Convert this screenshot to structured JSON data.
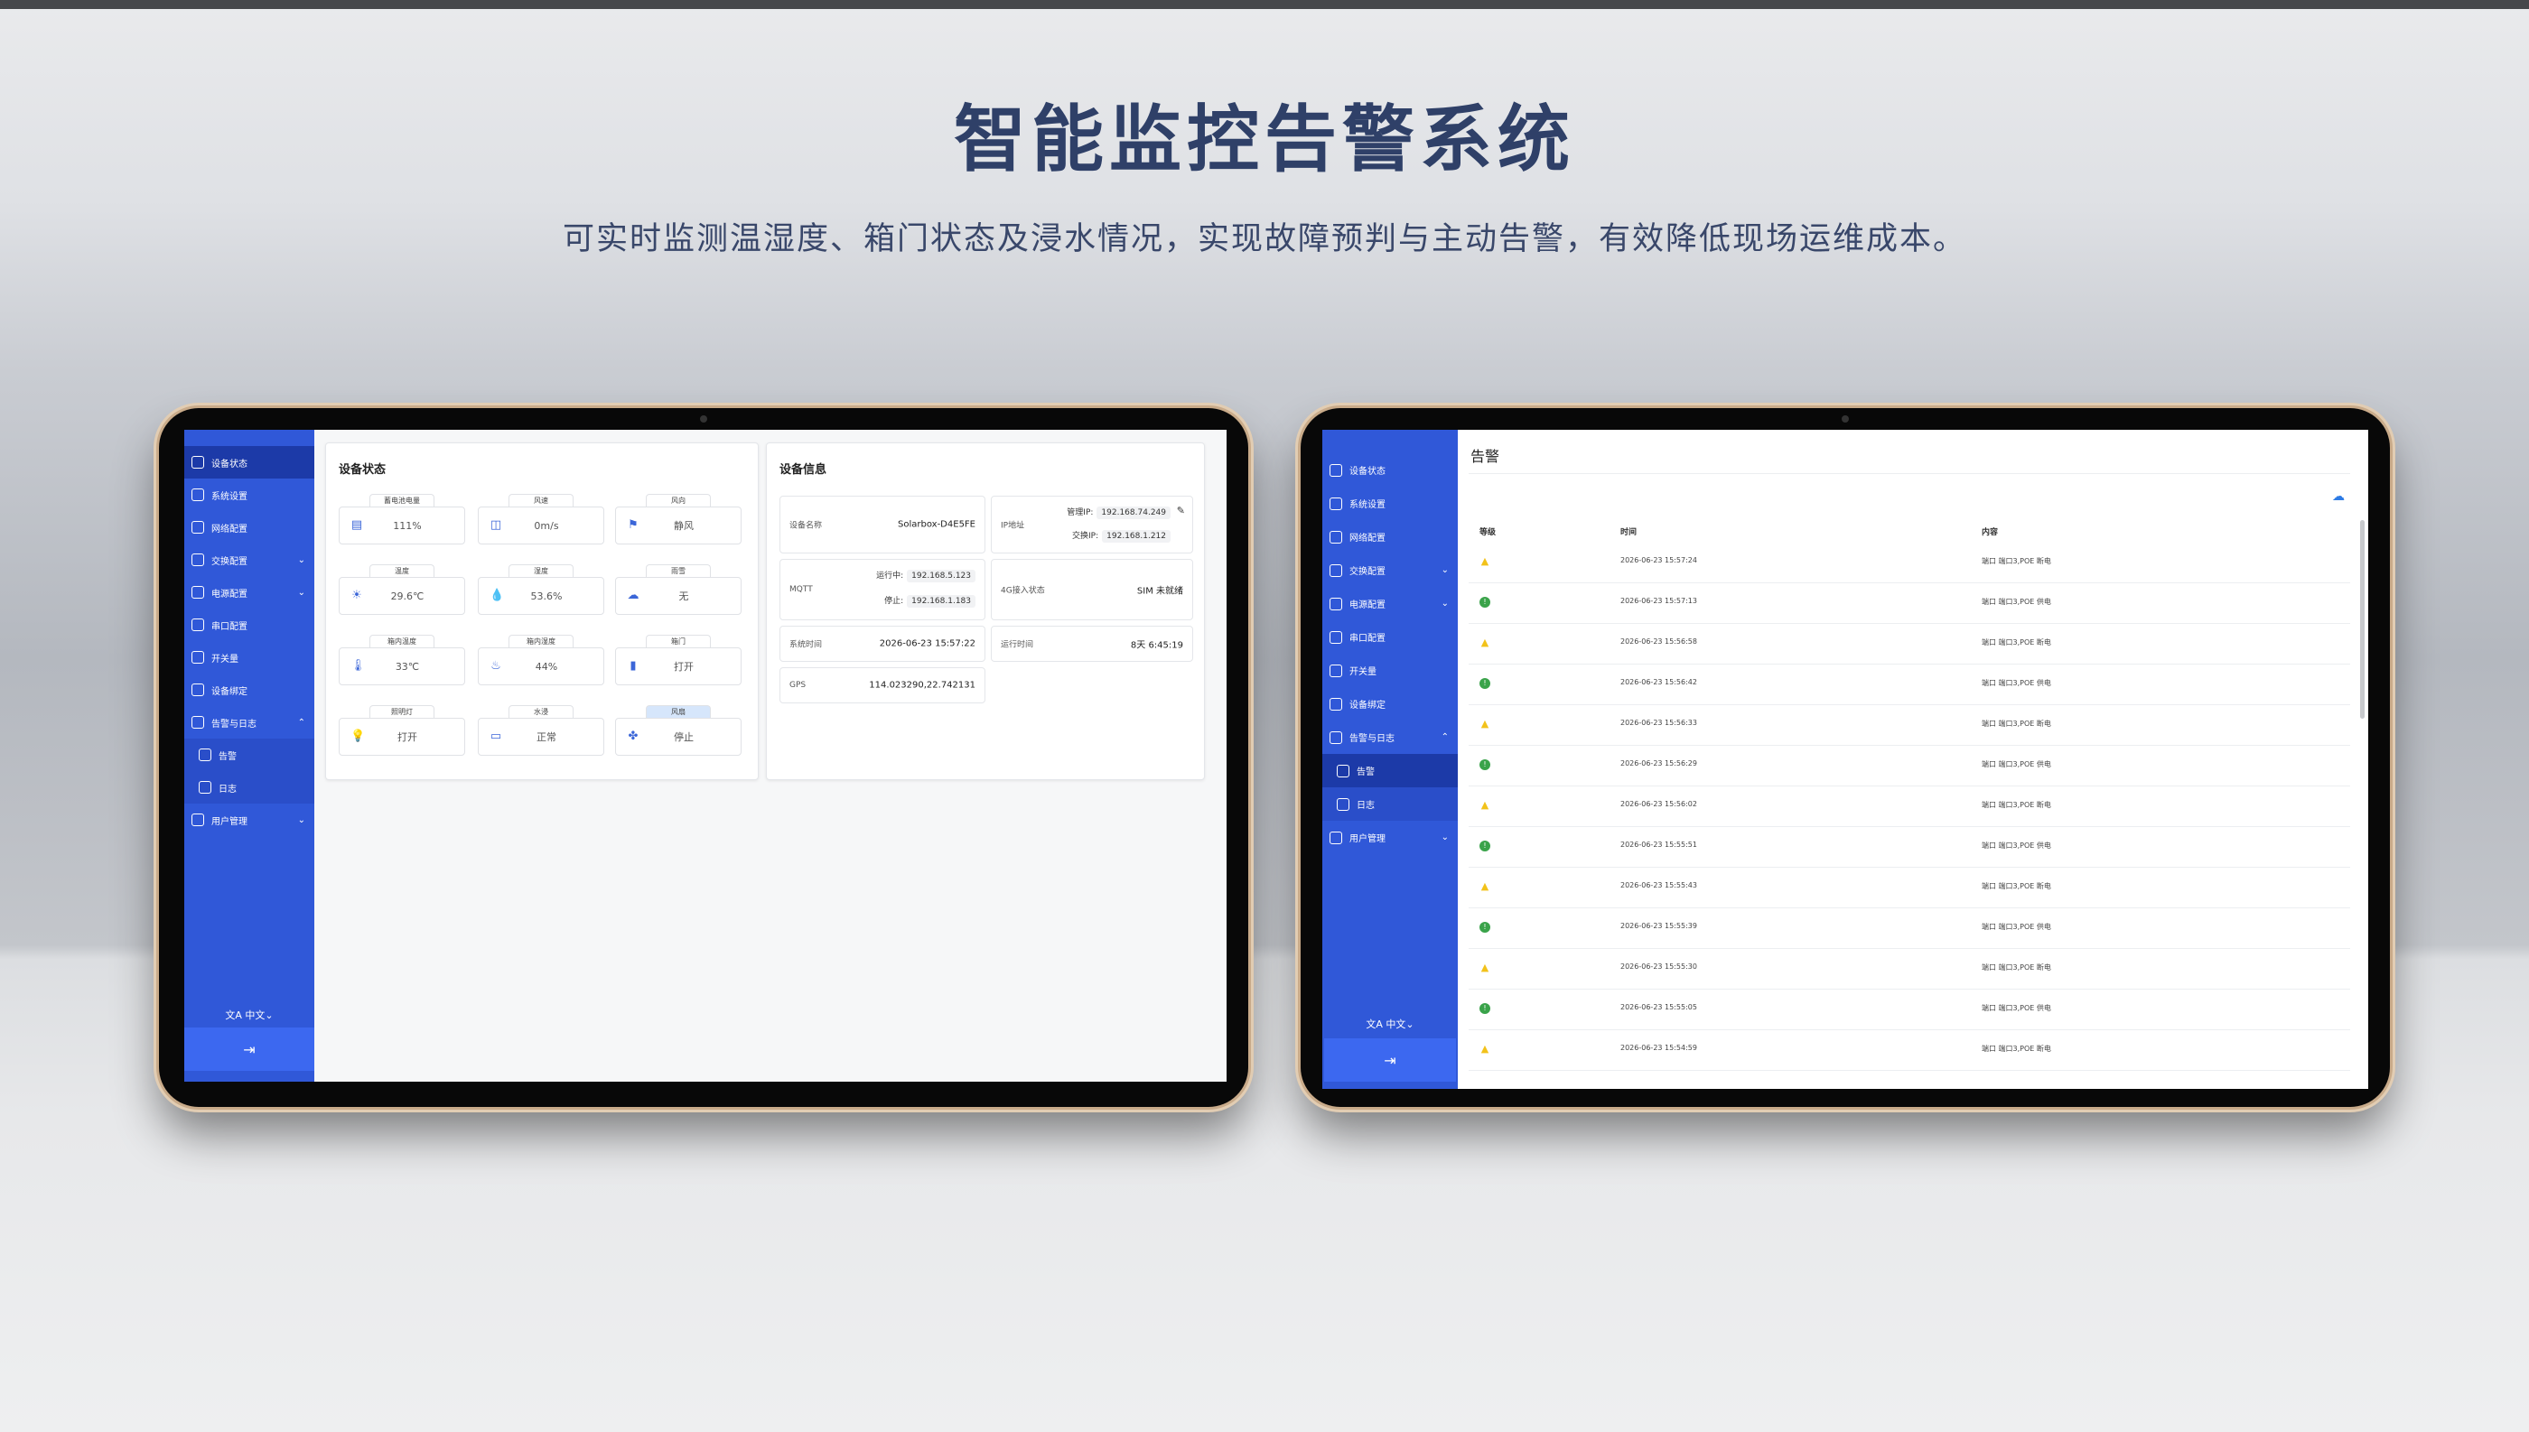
{
  "hero": {
    "title": "智能监控告警系统",
    "subtitle": "可实时监测温湿度、箱门状态及浸水情况，实现故障预判与主动告警，有效降低现场运维成本。"
  },
  "sidebar": {
    "items": [
      {
        "label": "设备状态",
        "icon": "monitor-icon"
      },
      {
        "label": "系统设置",
        "icon": "settings-icon"
      },
      {
        "label": "网络配置",
        "icon": "router-icon"
      },
      {
        "label": "交换配置",
        "icon": "switch-icon",
        "chevron": "⌄"
      },
      {
        "label": "电源配置",
        "icon": "battery-icon",
        "chevron": "⌄"
      },
      {
        "label": "串口配置",
        "icon": "serial-icon"
      },
      {
        "label": "开关量",
        "icon": "toggle-icon"
      },
      {
        "label": "设备绑定",
        "icon": "link-icon"
      },
      {
        "label": "告警与日志",
        "icon": "bell-icon",
        "chevron": "⌃"
      },
      {
        "label": "告警",
        "icon": "bell-icon"
      },
      {
        "label": "日志",
        "icon": "document-icon"
      },
      {
        "label": "用户管理",
        "icon": "user-icon",
        "chevron": "⌄"
      }
    ],
    "language": "中文",
    "language_chevron": "⌄",
    "logout_icon": "logout-icon"
  },
  "status": {
    "title": "设备状态",
    "sensors": [
      {
        "label": "蓄电池电量",
        "value": "111%",
        "icon": "battery-icon",
        "glyph": "▤"
      },
      {
        "label": "风速",
        "value": "0m/s",
        "icon": "wind-speed-icon",
        "glyph": "◫"
      },
      {
        "label": "风向",
        "value": "静风",
        "icon": "wind-direction-icon",
        "glyph": "⚑"
      },
      {
        "label": "温度",
        "value": "29.6℃",
        "icon": "sun-icon",
        "glyph": "☀"
      },
      {
        "label": "湿度",
        "value": "53.6%",
        "icon": "humidity-icon",
        "glyph": "💧"
      },
      {
        "label": "雨雪",
        "value": "无",
        "icon": "weather-icon",
        "glyph": "☁"
      },
      {
        "label": "箱内温度",
        "value": "33℃",
        "icon": "thermometer-icon",
        "glyph": "🌡"
      },
      {
        "label": "箱内湿度",
        "value": "44%",
        "icon": "humidity-gauge-icon",
        "glyph": "♨"
      },
      {
        "label": "箱门",
        "value": "打开",
        "icon": "door-icon",
        "glyph": "▮"
      },
      {
        "label": "照明灯",
        "value": "打开",
        "icon": "lamp-icon",
        "glyph": "💡"
      },
      {
        "label": "水浸",
        "value": "正常",
        "icon": "water-icon",
        "glyph": "▭"
      },
      {
        "label": "风扇",
        "value": "停止",
        "icon": "fan-icon",
        "glyph": "✤",
        "highlight": true
      }
    ]
  },
  "info": {
    "title": "设备信息",
    "device_name_label": "设备名称",
    "device_name": "Solarbox-D4E5FE",
    "ip_label": "IP地址",
    "mgmt_ip_label": "管理IP:",
    "mgmt_ip": "192.168.74.249",
    "switch_ip_label": "交换IP:",
    "switch_ip": "192.168.1.212",
    "mqtt_label": "MQTT",
    "mqtt_running_label": "运行中:",
    "mqtt_running": "192.168.5.123",
    "mqtt_stop_label": "停止:",
    "mqtt_stop": "192.168.1.183",
    "lte_label": "4G接入状态",
    "lte_value": "SIM 未就绪",
    "systime_label": "系统时间",
    "systime": "2026-06-23 15:57:22",
    "uptime_label": "运行时间",
    "uptime": "8天 6:45:19",
    "gps_label": "GPS",
    "gps": "114.023290,22.742131"
  },
  "alarms": {
    "title": "告警",
    "columns": [
      "等级",
      "时间",
      "内容"
    ],
    "rows": [
      {
        "level": "warn",
        "time": "2026-06-23 15:57:24",
        "content": "端口 端口3,POE 断电"
      },
      {
        "level": "ok",
        "time": "2026-06-23 15:57:13",
        "content": "端口 端口3,POE 供电"
      },
      {
        "level": "warn",
        "time": "2026-06-23 15:56:58",
        "content": "端口 端口3,POE 断电"
      },
      {
        "level": "ok",
        "time": "2026-06-23 15:56:42",
        "content": "端口 端口3,POE 供电"
      },
      {
        "level": "warn",
        "time": "2026-06-23 15:56:33",
        "content": "端口 端口3,POE 断电"
      },
      {
        "level": "ok",
        "time": "2026-06-23 15:56:29",
        "content": "端口 端口3,POE 供电"
      },
      {
        "level": "warn",
        "time": "2026-06-23 15:56:02",
        "content": "端口 端口3,POE 断电"
      },
      {
        "level": "ok",
        "time": "2026-06-23 15:55:51",
        "content": "端口 端口3,POE 供电"
      },
      {
        "level": "warn",
        "time": "2026-06-23 15:55:43",
        "content": "端口 端口3,POE 断电"
      },
      {
        "level": "ok",
        "time": "2026-06-23 15:55:39",
        "content": "端口 端口3,POE 供电"
      },
      {
        "level": "warn",
        "time": "2026-06-23 15:55:30",
        "content": "端口 端口3,POE 断电"
      },
      {
        "level": "ok",
        "time": "2026-06-23 15:55:05",
        "content": "端口 端口3,POE 供电"
      },
      {
        "level": "warn",
        "time": "2026-06-23 15:54:59",
        "content": "端口 端口3,POE 断电"
      }
    ],
    "download_icon": "cloud-download-icon"
  },
  "colors": {
    "sidebar": "#3058d8",
    "sidebar_active": "#1c3aa8",
    "title": "#2f4068",
    "warning": "#f2c21a",
    "ok": "#3aa34a"
  }
}
